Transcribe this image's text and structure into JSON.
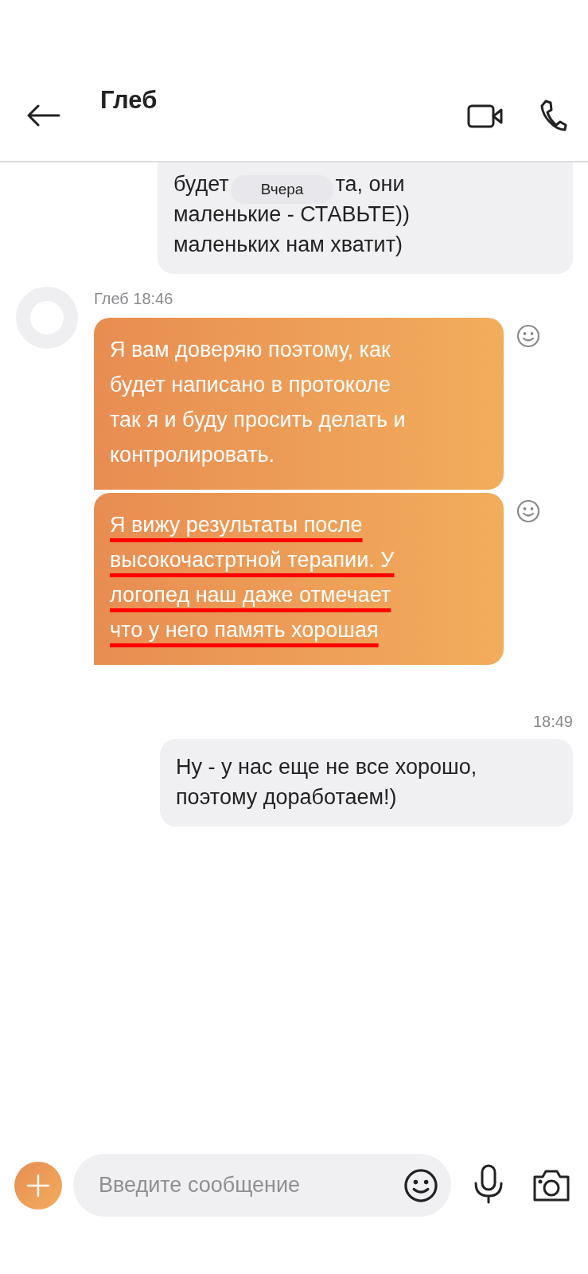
{
  "header": {
    "title": "Глеб"
  },
  "messages": [
    {
      "kind": "outgoing",
      "cut_top": true,
      "first_line": [
        "будет",
        "та, они"
      ],
      "day_label": "Вчера",
      "lines": [
        "маленькие - СТАВЬТЕ))",
        "маленьких нам хватит)"
      ]
    },
    {
      "kind": "incoming",
      "sender": "Глеб 18:46",
      "bubbles": [
        {
          "lines": [
            "Я вам доверяю поэтому, как",
            "будет написано в протоколе",
            "так  я и буду просить делать и",
            "контролировать."
          ],
          "underlined": false
        },
        {
          "lines": [
            "Я вижу результаты после",
            "высокочастртной терапии. У",
            "логопед наш даже отмечает",
            "что у него память хорошая"
          ],
          "underlined": true
        }
      ]
    },
    {
      "kind": "time",
      "text": "18:49"
    },
    {
      "kind": "outgoing",
      "lines": [
        "Ну - у нас еще не все хорошо,",
        "поэтому доработаем!)"
      ],
      "cut_top": false
    }
  ],
  "composer": {
    "placeholder": "Введите сообщение"
  }
}
